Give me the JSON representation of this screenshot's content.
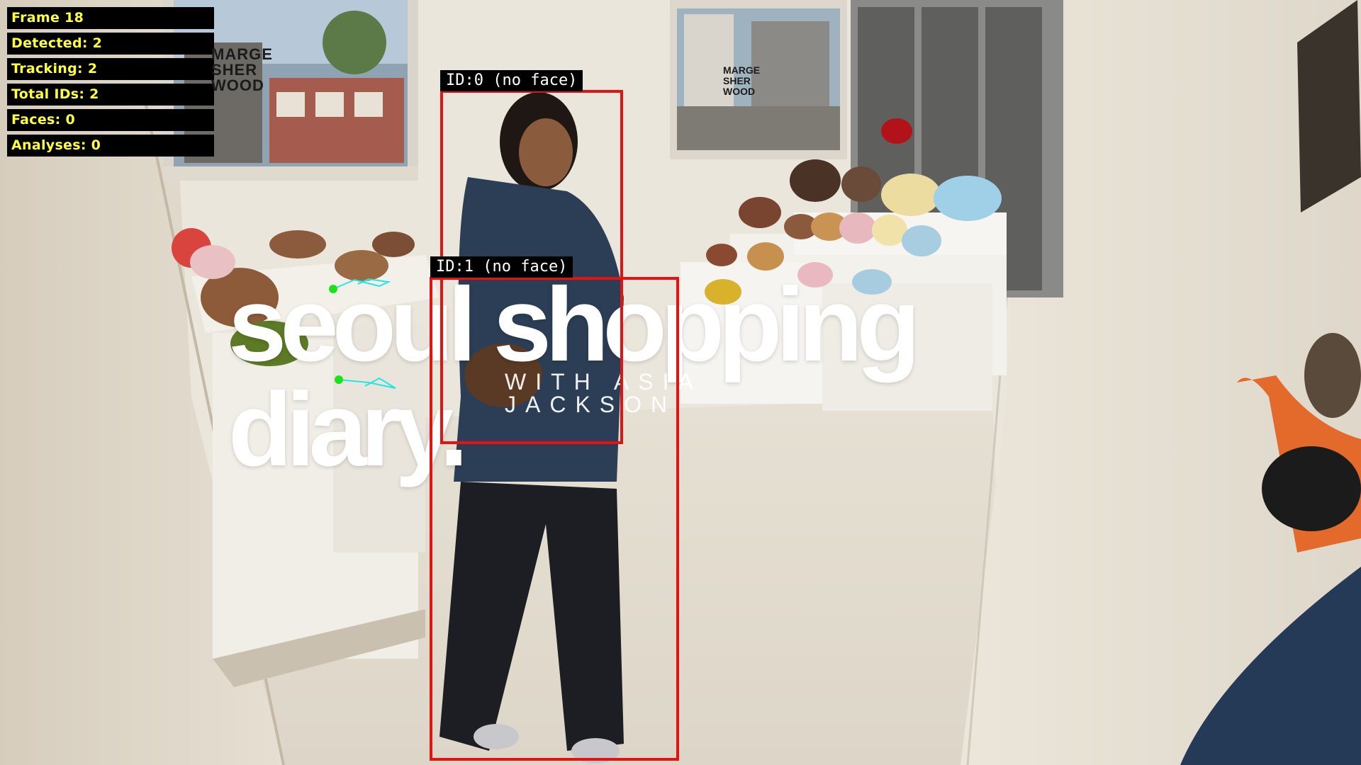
{
  "hud": {
    "frame": "Frame 18",
    "detected": "Detected: 2",
    "tracking": "Tracking: 2",
    "total_ids": "Total IDs: 2",
    "faces": "Faces: 0",
    "analyses": "Analyses: 0"
  },
  "detections": [
    {
      "label": "ID:0 (no face)"
    },
    {
      "label": "ID:1 (no face)"
    }
  ],
  "overlay": {
    "title": "seoul shopping diary.",
    "subtitle": "WITH ASIA JACKSON"
  },
  "store_signage": {
    "left_window": "MARGE SHER WOOD",
    "right_window": "MARGE SHER WOOD"
  },
  "colors": {
    "hud_text": "#ffff3a",
    "hud_bg": "#000000",
    "bbox": "#e41313",
    "track_trail": "#22e6e6",
    "track_point": "#1be21b"
  }
}
